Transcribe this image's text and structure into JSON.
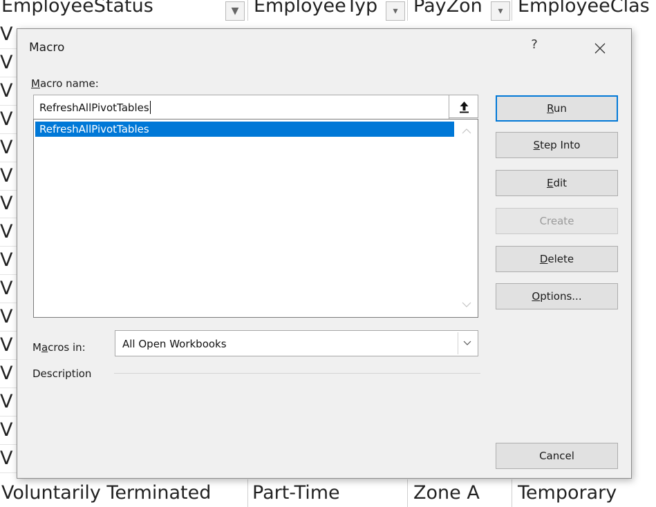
{
  "sheet": {
    "header": [
      {
        "text": "EmployeeStatus",
        "has_filter": true,
        "filter_glyph": "filter-arrow"
      },
      {
        "text": "EmployeeTyp",
        "has_filter": true,
        "filter_glyph": "dropdown-arrow"
      },
      {
        "text": "PayZon",
        "has_filter": true,
        "filter_glyph": "dropdown-arrow"
      },
      {
        "text": "EmployeeClas",
        "has_filter": false
      }
    ],
    "column_a_glyph": "V",
    "column_a_rows": 16,
    "footer": [
      "Voluntarily Terminated",
      "Part-Time",
      "Zone A",
      "Temporary"
    ]
  },
  "dialog": {
    "title": "Macro",
    "help_label": "?",
    "close_icon": "close-icon",
    "macro_name_label": {
      "accesskey": "M",
      "rest": "acro name:"
    },
    "macro_name_value": "RefreshAllPivotTables",
    "refedit_icon": "collapse-arrow-icon",
    "macro_list": [
      "RefreshAllPivotTables"
    ],
    "selected_index": 0,
    "macros_in_label": {
      "before": "M",
      "accesskey": "a",
      "rest": "cros in:"
    },
    "macros_in_value": "All Open Workbooks",
    "description_label": "Description",
    "buttons": {
      "run": {
        "accesskey": "R",
        "rest": "un"
      },
      "step_into": {
        "accesskey": "S",
        "rest": "tep Into"
      },
      "edit": {
        "accesskey": "E",
        "rest": "dit"
      },
      "create": "Create",
      "delete": {
        "accesskey": "D",
        "rest": "elete"
      },
      "options": {
        "accesskey": "O",
        "rest": "ptions..."
      },
      "cancel": "Cancel"
    }
  },
  "colors": {
    "selection": "#0078d7",
    "dialog_bg": "#f0f0f0",
    "button_bg": "#e1e1e1",
    "default_button_border": "#0078d7"
  }
}
